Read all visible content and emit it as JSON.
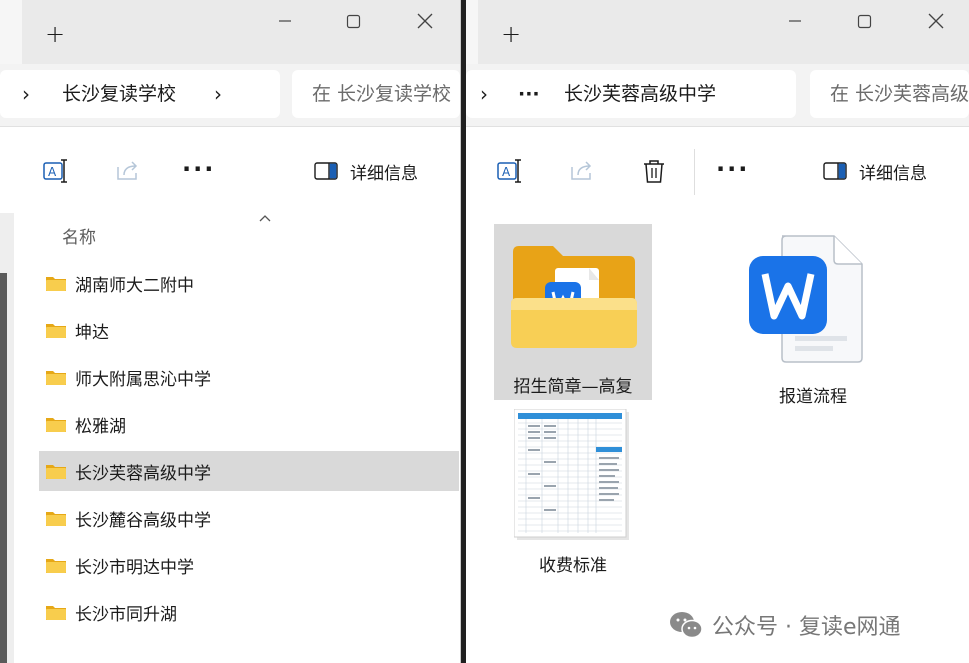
{
  "left_window": {
    "address": {
      "crumbs": [
        "长沙复读学校"
      ],
      "search_placeholder": "在 长沙复读学校"
    },
    "command_bar": {
      "details_label": "详细信息"
    },
    "list": {
      "column_header": "名称",
      "items": [
        {
          "label": "湖南师大二附中",
          "selected": false
        },
        {
          "label": "坤达",
          "selected": false
        },
        {
          "label": "师大附属思沁中学",
          "selected": false
        },
        {
          "label": "松雅湖",
          "selected": false
        },
        {
          "label": "长沙芙蓉高级中学",
          "selected": true
        },
        {
          "label": "长沙麓谷高级中学",
          "selected": false
        },
        {
          "label": "长沙市明达中学",
          "selected": false
        },
        {
          "label": "长沙市同升湖",
          "selected": false
        }
      ]
    }
  },
  "right_window": {
    "address": {
      "overflow": "···",
      "crumbs": [
        "长沙芙蓉高级中学"
      ],
      "search_placeholder": "在 长沙芙蓉高级"
    },
    "command_bar": {
      "details_label": "详细信息"
    },
    "files": [
      {
        "label": "招生简章—高复",
        "type": "folder",
        "selected": true
      },
      {
        "label": "报道流程",
        "type": "wps-document",
        "selected": false
      },
      {
        "label": "收费标准",
        "type": "spreadsheet-thumbnail",
        "selected": false
      }
    ]
  },
  "watermark": {
    "text": "公众号 · 复读e网通",
    "icon": "wechat-icon"
  },
  "icons": {
    "new_tab": "plus-icon",
    "minimize": "minimize-icon",
    "maximize": "maximize-icon",
    "close": "close-icon",
    "rename": "rename-icon",
    "share": "share-icon",
    "delete": "trash-icon",
    "more": "more-icon",
    "details": "details-pane-icon",
    "folder": "folder-icon"
  },
  "colors": {
    "folder": "#f5c342",
    "wps_blue": "#1a73e8",
    "selection": "#d9d9d9"
  }
}
